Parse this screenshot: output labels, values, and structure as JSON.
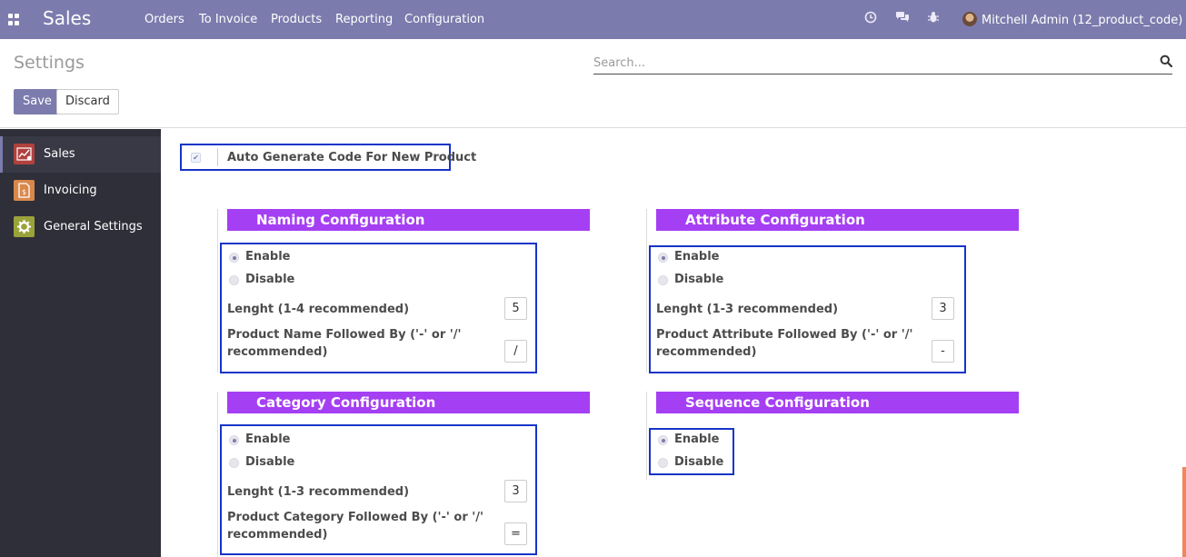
{
  "navbar": {
    "app_title": "Sales",
    "menu": [
      "Orders",
      "To Invoice",
      "Products",
      "Reporting",
      "Configuration"
    ],
    "user": "Mitchell Admin (12_product_code)"
  },
  "control_panel": {
    "title": "Settings",
    "search_placeholder": "Search...",
    "save_label": "Save",
    "discard_label": "Discard"
  },
  "sidebar": {
    "items": [
      {
        "label": "Sales",
        "icon": "sales-chart-icon",
        "color": "#b1413e"
      },
      {
        "label": "Invoicing",
        "icon": "invoicing-icon",
        "color": "#d9884b"
      },
      {
        "label": "General Settings",
        "icon": "gear-icon",
        "color": "#9aa33a"
      }
    ]
  },
  "content": {
    "auto_generate_label": "Auto Generate Code For New Product",
    "sections": {
      "naming": {
        "title": "Naming Configuration",
        "enable": "Enable",
        "disable": "Disable",
        "length_label": "Lenght (1-4 recommended)",
        "length_value": "5",
        "followed_label_1": "Product Name Followed By ('-' or '/'",
        "followed_label_2": "recommended)",
        "followed_value": "/"
      },
      "attribute": {
        "title": "Attribute Configuration",
        "enable": "Enable",
        "disable": "Disable",
        "length_label": "Lenght (1-3 recommended)",
        "length_value": "3",
        "followed_label_1": "Product Attribute Followed By ('-' or '/'",
        "followed_label_2": "recommended)",
        "followed_value": "-"
      },
      "category": {
        "title": "Category Configuration",
        "enable": "Enable",
        "disable": "Disable",
        "length_label": "Lenght (1-3 recommended)",
        "length_value": "3",
        "followed_label_1": "Product Category Followed By ('-' or '/'",
        "followed_label_2": "recommended)",
        "followed_value": "="
      },
      "sequence": {
        "title": "Sequence Configuration",
        "enable": "Enable",
        "disable": "Disable"
      }
    }
  },
  "colors": {
    "navbar": "#7c7bad",
    "section_header": "#a53ff3",
    "highlight_border": "#1635c8",
    "sidebar": "#2f2f3a"
  }
}
